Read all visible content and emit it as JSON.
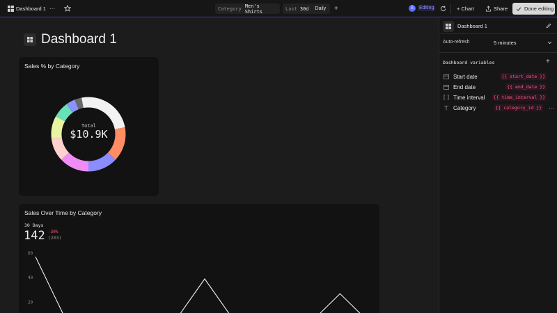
{
  "topbar": {
    "tab_name": "Dashboard 1",
    "more": "···",
    "filter_category_label": "Category",
    "filter_category_value": "Men's Shirts",
    "filter_range_prefix": "Last",
    "filter_range_value": "30d",
    "filter_granularity": "Daily",
    "add_filter": "+",
    "user_initial": "S",
    "mode_badge": "Editing",
    "chart_button": "+ Chart",
    "share_button": "Share",
    "done_button": "Done editing"
  },
  "page": {
    "title": "Dashboard 1"
  },
  "donut_card": {
    "title": "Sales % by Category",
    "center_label": "Total",
    "center_value": "$10.9K"
  },
  "line_card": {
    "title": "Sales Over Time by Category",
    "period_label": "30 Days",
    "big_value": "142",
    "change": "-30%",
    "previous": "(203)"
  },
  "chart_data": [
    {
      "type": "pie",
      "title": "Sales % by Category",
      "series": [
        {
          "value": 25,
          "color": "#f2f2f2"
        },
        {
          "value": 15,
          "color": "#ff8c63"
        },
        {
          "value": 13,
          "color": "#8b8cff"
        },
        {
          "value": 13,
          "color": "#f08cf5"
        },
        {
          "value": 10,
          "color": "#ffd0d0"
        },
        {
          "value": 10,
          "color": "#e8f5a0"
        },
        {
          "value": 7,
          "color": "#6ae0b8"
        },
        {
          "value": 4,
          "color": "#8a93ff"
        },
        {
          "value": 3,
          "color": "#6a6a6a"
        }
      ]
    },
    {
      "type": "line",
      "title": "Sales Over Time by Category",
      "yticks": [
        60,
        40,
        20
      ],
      "ylim": [
        0,
        65
      ],
      "x": [
        0,
        1,
        2,
        3,
        4,
        5,
        6,
        7,
        8,
        9,
        10
      ],
      "values": [
        57,
        0,
        0,
        0,
        0,
        39,
        0,
        0,
        0,
        27,
        0
      ]
    }
  ],
  "sidebar": {
    "title": "Dashboard 1",
    "autorefresh_label": "Auto-refresh",
    "autorefresh_value": "5 minutes",
    "variables_heading": "Dashboard variables",
    "add": "+",
    "variables": [
      {
        "label": "Start date",
        "token": "{{ start_date }}"
      },
      {
        "label": "End date",
        "token": "{{ end_date }}"
      },
      {
        "label": "Time interval",
        "token": "{{ time_interval }}"
      },
      {
        "label": "Category",
        "token": "{{ category_id }}"
      }
    ],
    "row_more": "···"
  }
}
